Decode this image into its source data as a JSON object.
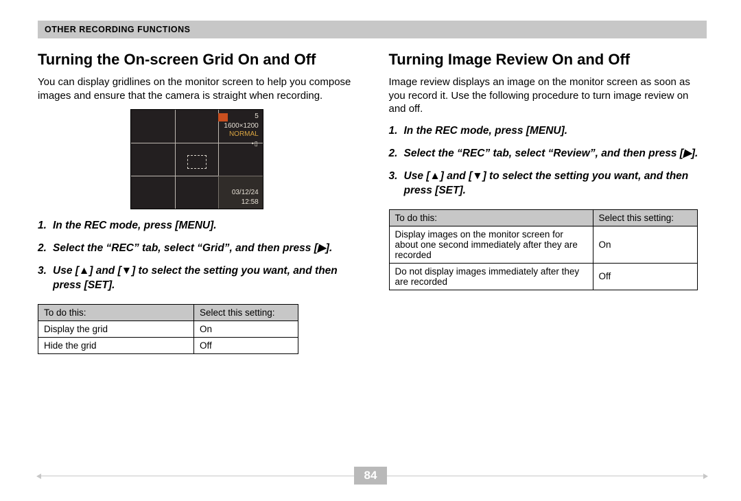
{
  "header": {
    "title": "OTHER RECORDING FUNCTIONS"
  },
  "page_number": "84",
  "left": {
    "title": "Turning the On-screen Grid On and Off",
    "lead": "You can display gridlines on the monitor screen to help you compose images and ensure that the camera is straight when recording.",
    "cam": {
      "count": "5",
      "res": "1600×1200",
      "quality": "NORMAL",
      "date": "03/12/24",
      "time": "12:58"
    },
    "steps": [
      {
        "num": "1.",
        "text": "In the REC mode, press [MENU]."
      },
      {
        "num": "2.",
        "text": "Select the “REC” tab, select “Grid”, and then press [▶]."
      },
      {
        "num": "3.",
        "text": "Use [▲] and [▼] to select the setting you want, and then press [SET]."
      }
    ],
    "table": {
      "head": [
        "To do this:",
        "Select this setting:"
      ],
      "rows": [
        [
          "Display the grid",
          "On"
        ],
        [
          "Hide the grid",
          "Off"
        ]
      ]
    }
  },
  "right": {
    "title": "Turning Image Review On and Off",
    "lead": "Image review displays an image on the monitor screen as soon as you record it. Use the following procedure to turn image review on and off.",
    "steps": [
      {
        "num": "1.",
        "text": "In the REC mode, press [MENU]."
      },
      {
        "num": "2.",
        "text": "Select the “REC” tab, select “Review”, and then press [▶]."
      },
      {
        "num": "3.",
        "text": "Use [▲] and [▼] to select the setting you want, and then press [SET]."
      }
    ],
    "table": {
      "head": [
        "To do this:",
        "Select this setting:"
      ],
      "rows": [
        [
          "Display images on the monitor screen for about one second immediately after they are recorded",
          "On"
        ],
        [
          "Do not display images immediately after they are recorded",
          "Off"
        ]
      ]
    }
  }
}
